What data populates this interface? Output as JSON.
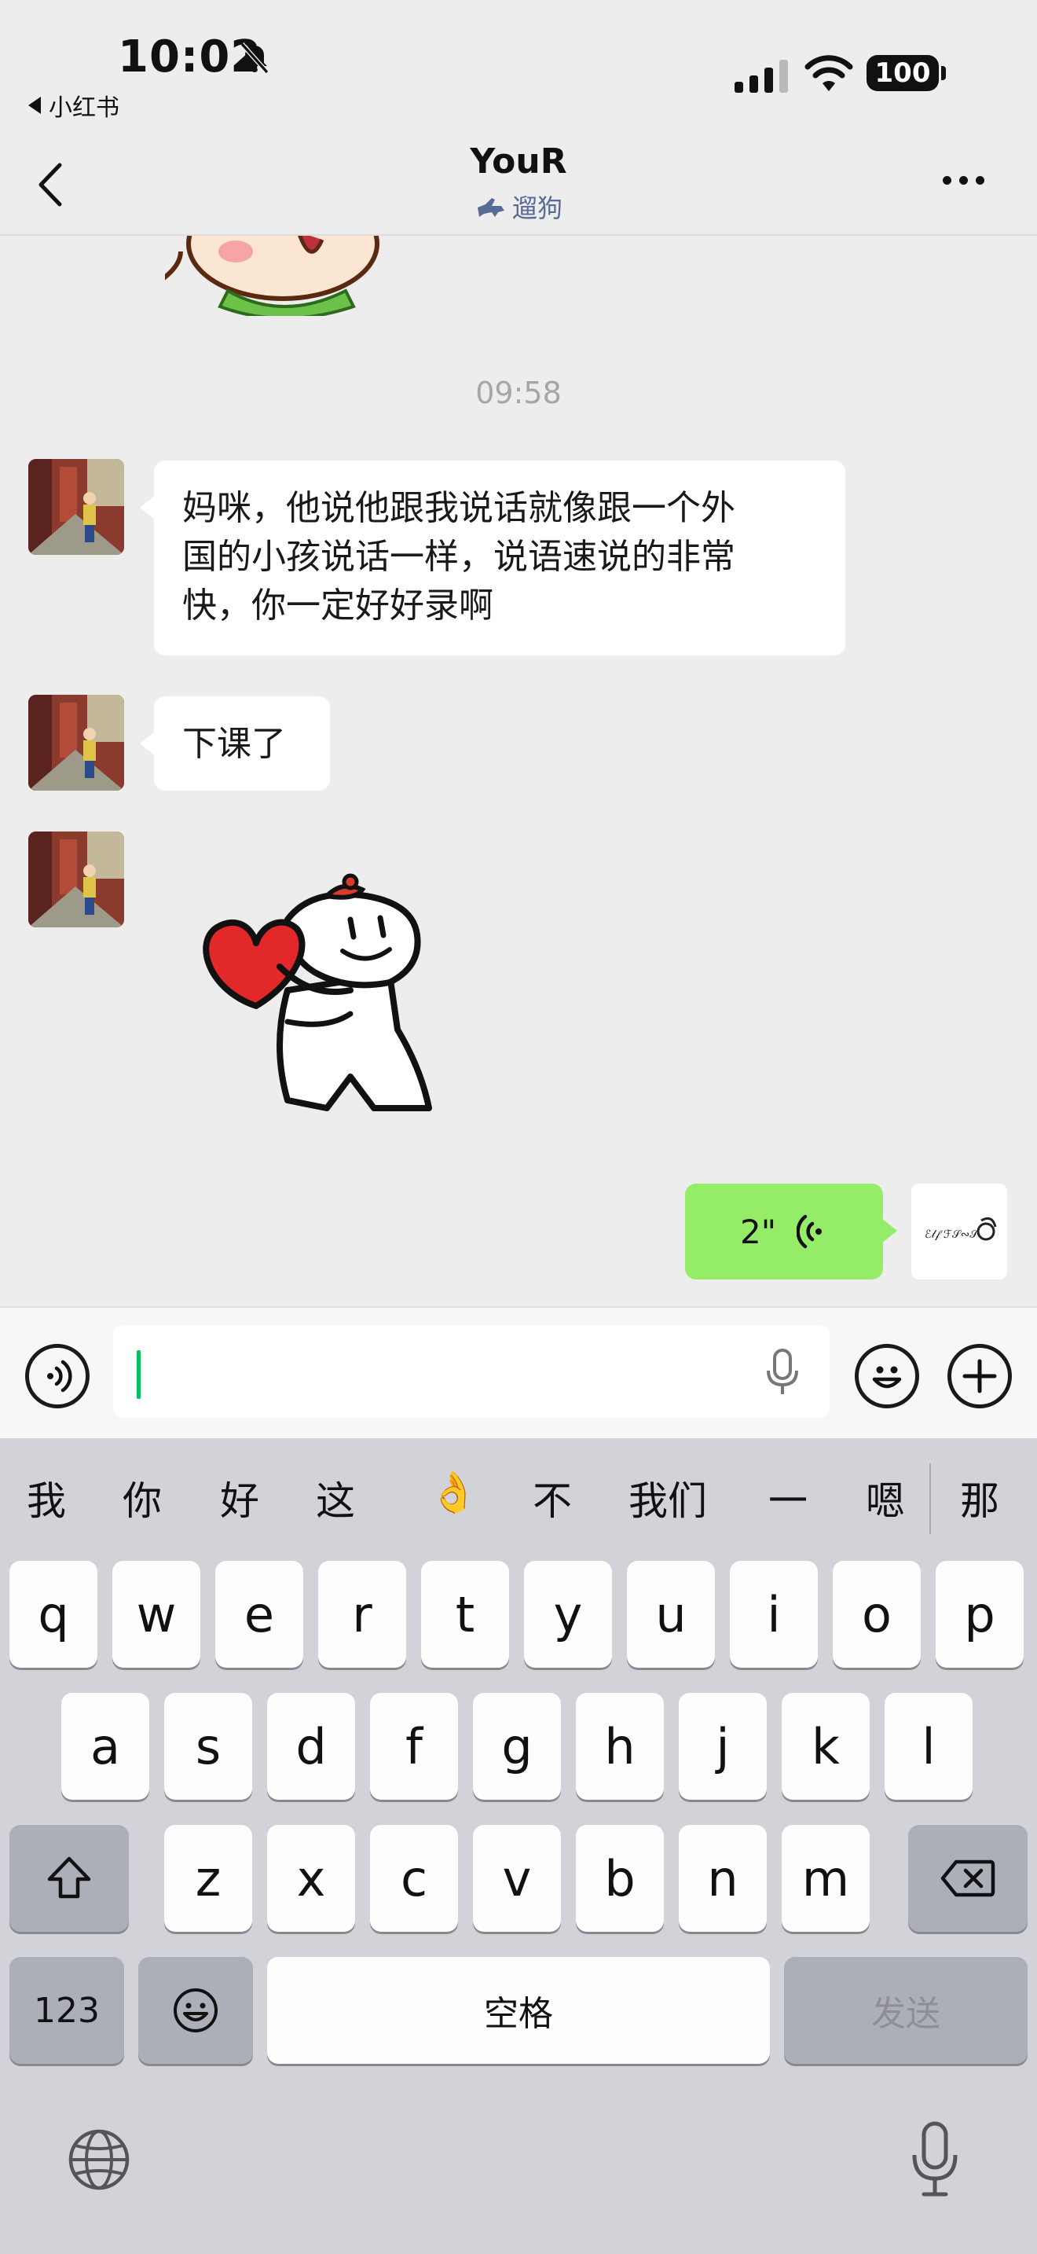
{
  "status_bar": {
    "time": "10:02",
    "back_app": "小红书",
    "battery": "100"
  },
  "header": {
    "title": "YouR",
    "subtitle": "遛狗"
  },
  "timestamp": "09:58",
  "messages": [
    {
      "from": "other",
      "type": "text",
      "text": "妈咪，他说他跟我说话就像跟一个外\n国的小孩说话一样，说语速说的非常\n快，你一定好好录啊"
    },
    {
      "from": "other",
      "type": "text",
      "text": "下课了"
    },
    {
      "from": "other",
      "type": "sticker",
      "icon": "bear-heart-sticker"
    },
    {
      "from": "me",
      "type": "voice",
      "duration": "2\""
    }
  ],
  "keyboard": {
    "suggestions": [
      "我",
      "你",
      "好",
      "这",
      "👌",
      "不",
      "我们",
      "一",
      "嗯",
      "那"
    ],
    "row1": [
      "q",
      "w",
      "e",
      "r",
      "t",
      "y",
      "u",
      "i",
      "o",
      "p"
    ],
    "row2": [
      "a",
      "s",
      "d",
      "f",
      "g",
      "h",
      "j",
      "k",
      "l"
    ],
    "row3": [
      "z",
      "x",
      "c",
      "v",
      "b",
      "n",
      "m"
    ],
    "numbers_label": "123",
    "space_label": "空格",
    "send_label": "发送"
  },
  "colors": {
    "bubble_out": "#95ec69",
    "caret": "#07c160",
    "subtitle": "#576b95",
    "timestamp": "#a6a6a6"
  }
}
